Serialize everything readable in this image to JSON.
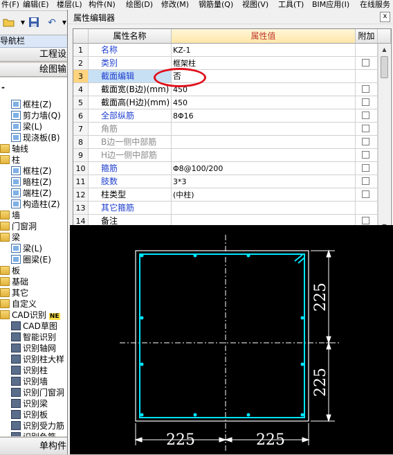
{
  "menu": [
    "件(F)",
    "编辑(E)",
    "楼层(L)",
    "构件(N)",
    "绘图(D)",
    "修改(M)",
    "钢筋量(Q)",
    "视图(V)",
    "工具(T)",
    "BIM应用(I)",
    "在线服务"
  ],
  "toolbar": {
    "open_icon": "open-folder-icon",
    "save_icon": "save-icon",
    "undo_icon": "undo-icon"
  },
  "nav": {
    "title": "导航栏",
    "btn1": "工程设",
    "btn2": "绘图输",
    "minus": "-",
    "tree": [
      {
        "label": "框柱(Z)",
        "icon": "column-icon"
      },
      {
        "label": "剪力墙(Q)",
        "icon": "wall-icon"
      },
      {
        "label": "梁(L)",
        "icon": "beam-icon"
      },
      {
        "label": "现浇板(B)",
        "icon": "slab-icon"
      },
      {
        "label": "轴线",
        "icon": "folder-icon"
      },
      {
        "label": "柱",
        "icon": "folder-icon"
      },
      {
        "label": "框柱(Z)",
        "icon": "column-icon"
      },
      {
        "label": "暗柱(Z)",
        "icon": "column-icon"
      },
      {
        "label": "端柱(Z)",
        "icon": "column-icon"
      },
      {
        "label": "构造柱(Z)",
        "icon": "column-icon"
      },
      {
        "label": "墙",
        "icon": "folder-icon"
      },
      {
        "label": "门窗洞",
        "icon": "folder-icon"
      },
      {
        "label": "梁",
        "icon": "folder-icon"
      },
      {
        "label": "梁(L)",
        "icon": "beam-icon"
      },
      {
        "label": "圈梁(E)",
        "icon": "beam-icon"
      },
      {
        "label": "板",
        "icon": "folder-icon"
      },
      {
        "label": "基础",
        "icon": "folder-icon"
      },
      {
        "label": "其它",
        "icon": "folder-icon"
      },
      {
        "label": "自定义",
        "icon": "folder-icon"
      },
      {
        "label": "CAD识别",
        "icon": "folder-icon"
      },
      {
        "label": "CAD草图",
        "icon": "cad-icon"
      },
      {
        "label": "智能识别",
        "icon": "cad-icon"
      },
      {
        "label": "识别轴网",
        "icon": "cad-icon"
      },
      {
        "label": "识别柱大样",
        "icon": "cad-icon"
      },
      {
        "label": "识别柱",
        "icon": "cad-icon"
      },
      {
        "label": "识别墙",
        "icon": "cad-icon"
      },
      {
        "label": "识别门窗洞",
        "icon": "cad-icon"
      },
      {
        "label": "识别梁",
        "icon": "cad-icon"
      },
      {
        "label": "识别板",
        "icon": "cad-icon"
      },
      {
        "label": "识别受力筋",
        "icon": "cad-icon"
      },
      {
        "label": "识别负筋",
        "icon": "cad-icon"
      }
    ],
    "new_badge": "NE",
    "bottom_tab": "单构件"
  },
  "dialog": {
    "title": "属性编辑器",
    "close": "x",
    "headers": {
      "name": "属性名称",
      "value": "属性值",
      "add": "附加"
    },
    "rows": [
      {
        "num": "1",
        "name": "名称",
        "value": "KZ-1",
        "style": "blue",
        "checkbox": false
      },
      {
        "num": "2",
        "name": "类别",
        "value": "框架柱",
        "style": "blue",
        "checkbox": true
      },
      {
        "num": "3",
        "name": "截面编辑",
        "value": "否",
        "style": "blue",
        "checkbox": false,
        "selected": true
      },
      {
        "num": "4",
        "name": "截面宽(B边)(mm)",
        "value": "450",
        "style": "black",
        "checkbox": true
      },
      {
        "num": "5",
        "name": "截面高(H边)(mm)",
        "value": "450",
        "style": "black",
        "checkbox": true
      },
      {
        "num": "6",
        "name": "全部纵筋",
        "value": "8Φ16",
        "style": "blue",
        "checkbox": true
      },
      {
        "num": "7",
        "name": "角筋",
        "value": "",
        "style": "gray",
        "checkbox": true
      },
      {
        "num": "8",
        "name": "B边一侧中部筋",
        "value": "",
        "style": "gray",
        "checkbox": true
      },
      {
        "num": "9",
        "name": "H边一侧中部筋",
        "value": "",
        "style": "gray",
        "checkbox": true
      },
      {
        "num": "10",
        "name": "箍筋",
        "value": "Φ8@100/200",
        "style": "blue",
        "checkbox": true
      },
      {
        "num": "11",
        "name": "肢数",
        "value": "3*3",
        "style": "blue",
        "checkbox": true
      },
      {
        "num": "12",
        "name": "柱类型",
        "value": "(中柱)",
        "style": "black",
        "checkbox": true
      },
      {
        "num": "13",
        "name": "其它箍筋",
        "value": "",
        "style": "blue",
        "checkbox": false
      },
      {
        "num": "14",
        "name": "备注",
        "value": "",
        "style": "black",
        "checkbox": true
      }
    ],
    "drawing": {
      "dim_h_left": "225",
      "dim_h_right": "225",
      "dim_v_top": "225",
      "dim_v_bottom": "225"
    },
    "colors": {
      "rebar": "#00e5ff",
      "annotation": "#e0101c",
      "line": "#ffffff"
    }
  }
}
